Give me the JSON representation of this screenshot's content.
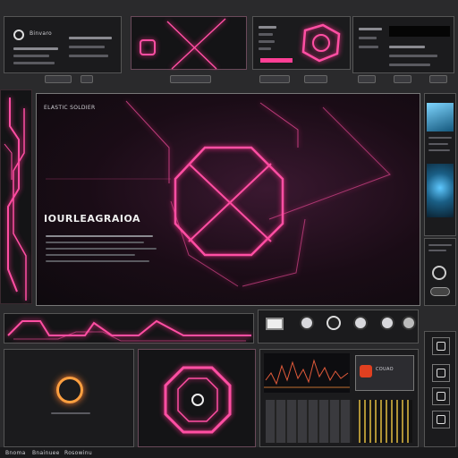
{
  "main": {
    "header_label": "ELASTIC SOLDIER",
    "big_title": "IOURLEAGRAIOA"
  },
  "top_left": {
    "label": "Binvaro"
  },
  "bottom_bar": {
    "items": [
      "Bnoma",
      "Bnainuee",
      "Rosowinu"
    ]
  },
  "bottom_mid": {
    "chip_label": "COUAO"
  },
  "colors": {
    "accent": "#ff4fa3",
    "blue": "#2aa9e0",
    "bg": "#2a2a2c"
  },
  "icons": [
    "gear-icon",
    "settings-icon",
    "toggle-icon",
    "close-icon",
    "grid-icon",
    "face-icon",
    "emoji-icon"
  ]
}
